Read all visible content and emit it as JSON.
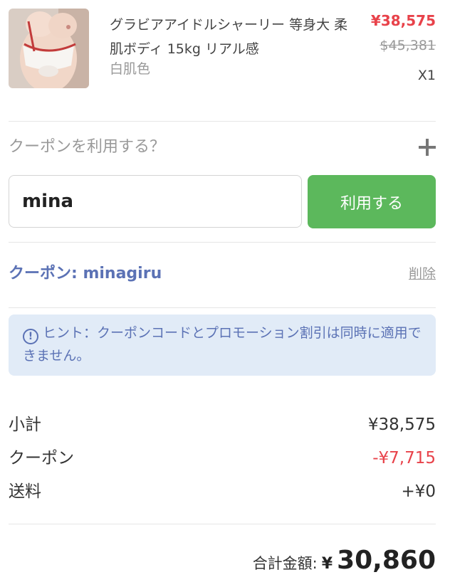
{
  "product": {
    "title": "グラビアアイドルシャーリー 等身大 柔肌ボディ 15kg リアル感",
    "variant": "白肌色",
    "price": "¥38,575",
    "original_price": "$45,381",
    "quantity": "X1"
  },
  "coupon": {
    "prompt": "クーポンを利用する？",
    "input_value": "mina",
    "apply_label": "利用する",
    "applied_text": "クーポン: minagiru",
    "remove_label": "削除",
    "hint": "ヒント：クーポンコードとプロモーション割引は同時に適用できません。"
  },
  "summary": {
    "subtotal_label": "小計",
    "subtotal_value": "¥38,575",
    "coupon_label": "クーポン",
    "coupon_value": "-¥7,715",
    "shipping_label": "送料",
    "shipping_value": "+¥0",
    "total_label": "合計金額:",
    "total_currency": "¥",
    "total_value": "30,860"
  },
  "colors": {
    "price_red": "#e8424a",
    "apply_green": "#5cb85c",
    "coupon_blue": "#5b72b5",
    "hint_bg": "#e1ebf7"
  }
}
